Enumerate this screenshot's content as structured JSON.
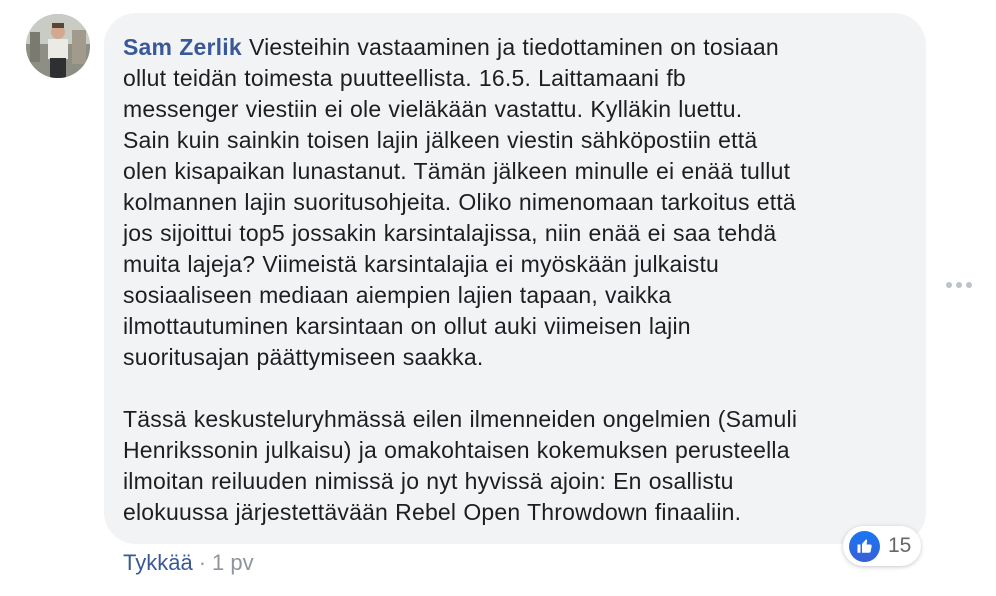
{
  "comment": {
    "author": "Sam Zerlik",
    "lines_p1": [
      "Viesteihin vastaaminen ja tiedottaminen on tosiaan",
      "ollut teidän toimesta puutteellista. 16.5. Laittamaani fb",
      "messenger viestiin ei ole vieläkään vastattu. Kylläkin luettu.",
      "Sain kuin sainkin toisen lajin jälkeen viestin sähköpostiin että",
      "olen kisapaikan lunastanut. Tämän jälkeen minulle ei enää tullut",
      "kolmannen lajin suoritusohjeita. Oliko nimenomaan tarkoitus että",
      "jos sijoittui top5 jossakin karsintalajissa, niin enää ei saa tehdä",
      "muita lajeja? Viimeistä karsintalajia ei myöskään julkaistu",
      "sosiaaliseen mediaan aiempien lajien tapaan, vaikka",
      "ilmottautuminen karsintaan on ollut auki viimeisen lajin",
      "suoritusajan päättymiseen saakka."
    ],
    "lines_p2": [
      "Tässä keskusteluryhmässä eilen ilmenneiden ongelmien (Samuli",
      "Henrikssonin julkaisu) ja omakohtaisen kokemuksen perusteella",
      "ilmoitan reiluuden nimissä jo nyt hyvissä ajoin: En osallistu",
      "elokuussa järjestettävään Rebel Open Throwdown finaaliin."
    ],
    "reaction_count": "15",
    "like_label": "Tykkää",
    "separator": "·",
    "time": "1 pv"
  },
  "icons": {
    "avatar": "avatar",
    "reaction": "thumbs-up-icon",
    "more": "more-options-icon"
  },
  "colors": {
    "author": "#385898",
    "bubble": "#f2f3f5",
    "like_blue": "#1877f2",
    "meta": "#90949c"
  }
}
